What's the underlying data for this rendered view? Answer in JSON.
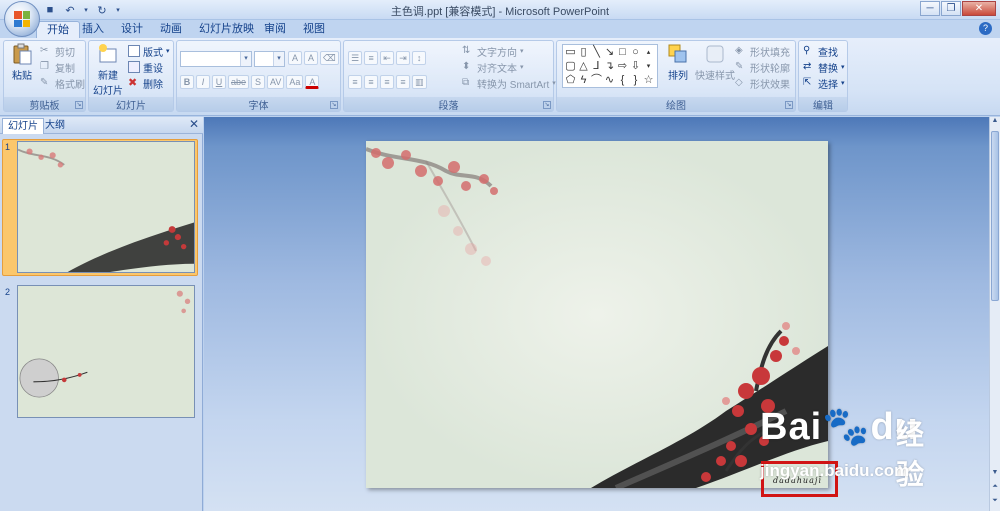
{
  "window": {
    "title": "主色调.ppt [兼容模式] - Microsoft PowerPoint",
    "controls": {
      "minimize": "─",
      "restore": "❐",
      "close": "✕"
    }
  },
  "tabs": [
    "开始",
    "插入",
    "设计",
    "动画",
    "幻灯片放映",
    "审阅",
    "视图"
  ],
  "ribbon": {
    "clipboard": {
      "paste": "粘贴",
      "cut": "剪切",
      "copy": "复制",
      "format_painter": "格式刷",
      "label": "剪贴板"
    },
    "slides": {
      "new_slide_line1": "新建",
      "new_slide_line2": "幻灯片",
      "layout": "版式",
      "reset": "重设",
      "delete": "删除",
      "label": "幻灯片"
    },
    "font": {
      "label": "字体",
      "bold": "B",
      "italic": "I",
      "underline": "U",
      "strike": "abe",
      "shadow": "S",
      "spacing": "AV",
      "case": "Aa",
      "grow": "A",
      "shrink": "A"
    },
    "paragraph": {
      "text_direction": "文字方向",
      "align_text": "对齐文本",
      "smartart": "转换为 SmartArt",
      "label": "段落"
    },
    "drawing": {
      "arrange": "排列",
      "quick_styles": "快速样式",
      "shape_fill": "形状填充",
      "shape_outline": "形状轮廓",
      "shape_effects": "形状效果",
      "label": "绘图"
    },
    "editing": {
      "find": "查找",
      "replace": "替换",
      "select": "选择",
      "label": "编辑"
    }
  },
  "panel": {
    "tab_slides": "幻灯片",
    "tab_outline": "大纲",
    "close": "✕",
    "slides": [
      {
        "num": "1"
      },
      {
        "num": "2"
      }
    ]
  },
  "slide": {
    "signature": "dadahuajī"
  },
  "watermark": {
    "logo": "Bai",
    "logo2": "du",
    "cn": "经验",
    "url": "jingyan.baidu.com"
  },
  "colors": {
    "accent": "#15428b",
    "ribbon": "#d5e3f6",
    "slide_bg": "#dce6d9",
    "highlight": "#d11414",
    "selection": "#fbc76c"
  }
}
